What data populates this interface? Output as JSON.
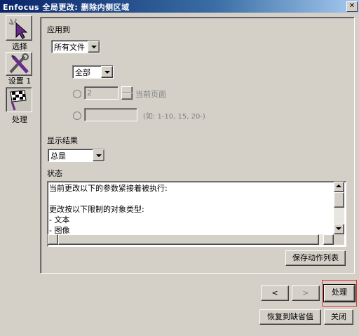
{
  "window": {
    "title": "Enfocus 全局更改: 删除内侧区域",
    "close_glyph": "✕"
  },
  "sidebar": {
    "items": [
      {
        "label": "选择",
        "icon": "select-cursor-icon"
      },
      {
        "label": "设置 1",
        "icon": "tools-settings-icon"
      },
      {
        "label": "处理",
        "icon": "checkered-flag-icon"
      }
    ]
  },
  "apply_to": {
    "label": "应用到",
    "scope_value": "所有文件",
    "pages_value": "全部",
    "page_number_value": "2",
    "current_page_label": "当前页面",
    "range_value": "",
    "range_hint": "(如: 1-10, 15, 20-)"
  },
  "display_results": {
    "label": "显示结果",
    "value": "总是"
  },
  "status": {
    "label": "状态",
    "lines": [
      "当前更改以下的参数紧接着被执行:",
      "",
      "更改按以下限制的对象类型:",
      "- 文本",
      "- 图像"
    ]
  },
  "buttons": {
    "save_action_list": "保存动作列表",
    "prev": "<",
    "next": ">",
    "process": "处理",
    "restore_defaults": "恢复到缺省值",
    "close": "关闭"
  },
  "colors": {
    "titlebar_start": "#0a246a",
    "dialog_face": "#d4d0c8",
    "highlight_box": "#e03030"
  }
}
